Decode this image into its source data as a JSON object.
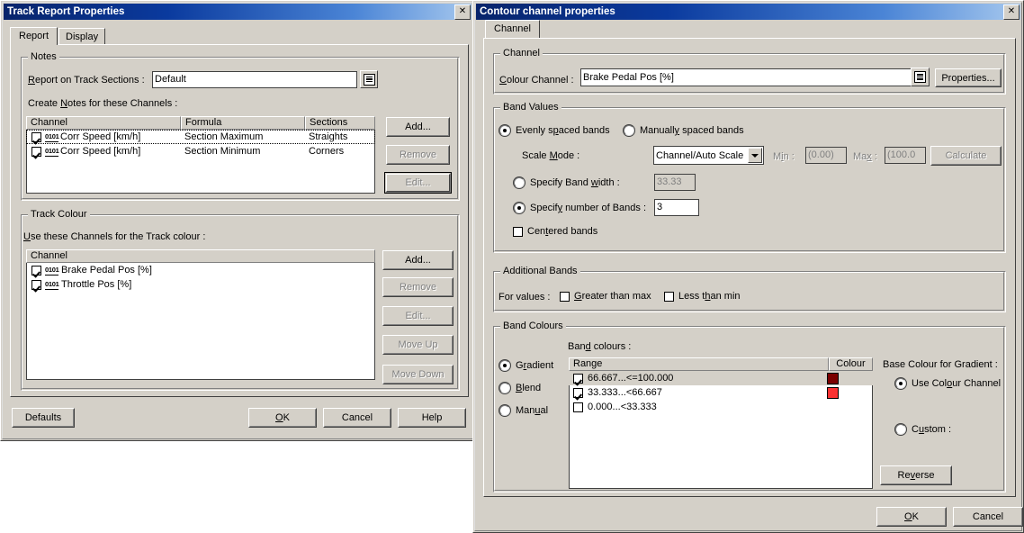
{
  "left_dialog": {
    "title": "Track Report Properties",
    "close_label": "✕",
    "tabs": [
      {
        "label": "Report",
        "selected": true
      },
      {
        "label": "Display",
        "selected": false
      }
    ],
    "notes_group": {
      "title": "Notes",
      "report_on_label": "Report on Track Sections :",
      "report_on_value": "Default",
      "browse_icon": "list-icon",
      "create_notes_label": "Create Notes for these Channels :",
      "columns": [
        "Channel",
        "Formula",
        "Sections"
      ],
      "rows": [
        {
          "checked": true,
          "icon": "0101",
          "channel": "Corr Speed [km/h]",
          "formula": "Section Maximum",
          "sections": "Straights",
          "focused": true
        },
        {
          "checked": true,
          "icon": "0101",
          "channel": "Corr Speed [km/h]",
          "formula": "Section Minimum",
          "sections": "Corners",
          "focused": false
        }
      ],
      "buttons": [
        {
          "label": "Add...",
          "enabled": true,
          "default": false
        },
        {
          "label": "Remove",
          "enabled": false,
          "default": false
        },
        {
          "label": "Edit...",
          "enabled": false,
          "default": true
        }
      ]
    },
    "track_colour_group": {
      "title": "Track Colour",
      "use_channels_label": "Use these Channels for the Track colour :",
      "columns": [
        "Channel"
      ],
      "rows": [
        {
          "checked": true,
          "icon": "0101",
          "channel": "Brake Pedal Pos [%]"
        },
        {
          "checked": true,
          "icon": "0101",
          "channel": "Throttle Pos [%]"
        }
      ],
      "buttons": [
        {
          "label": "Add...",
          "enabled": true
        },
        {
          "label": "Remove",
          "enabled": false
        },
        {
          "label": "Edit...",
          "enabled": false
        },
        {
          "label": "Move Up",
          "enabled": false
        },
        {
          "label": "Move Down",
          "enabled": false
        }
      ]
    },
    "footer_buttons": [
      {
        "label": "Defaults",
        "default": false
      },
      {
        "label": "OK",
        "default": false
      },
      {
        "label": "Cancel",
        "default": false
      },
      {
        "label": "Help",
        "default": false
      }
    ]
  },
  "right_dialog": {
    "title": "Contour channel properties",
    "close_label": "✕",
    "tabs": [
      {
        "label": "Channel",
        "selected": true
      }
    ],
    "channel_group": {
      "title": "Channel",
      "colour_channel_label": "Colour Channel :",
      "colour_channel_value": "Brake Pedal Pos [%]",
      "browse_icon": "list-icon",
      "properties_button": "Properties..."
    },
    "band_values_group": {
      "title": "Band Values",
      "spacing_mode": "evenly",
      "evenly_label": "Evenly spaced bands",
      "manually_label": "Manually spaced bands",
      "scale_mode_label": "Scale Mode :",
      "scale_mode_value": "Channel/Auto Scale",
      "min_label": "Min :",
      "min_value": "(0.00)",
      "max_label": "Max :",
      "max_value": "(100.0",
      "calculate_button": "Calculate",
      "band_width_label": "Specify Band width :",
      "band_width_value": "33.33",
      "band_width_selected": false,
      "number_of_bands_label": "Specify number of Bands :",
      "number_of_bands_value": "3",
      "number_of_bands_selected": true,
      "centered_bands_label": "Centered bands",
      "centered_bands_checked": false
    },
    "additional_bands_group": {
      "title": "Additional Bands",
      "for_values_label": "For values :",
      "greater_than_max_label": "Greater than max",
      "greater_than_max_checked": false,
      "less_than_min_label": "Less than min",
      "less_than_min_checked": false
    },
    "band_colours_group": {
      "title": "Band Colours",
      "mode": "gradient",
      "modes": [
        {
          "label": "Gradient",
          "selected": true
        },
        {
          "label": "Blend",
          "selected": false
        },
        {
          "label": "Manual",
          "selected": false
        }
      ],
      "band_colours_label": "Band colours :",
      "columns": [
        "Range",
        "Colour"
      ],
      "rows": [
        {
          "checked": true,
          "range": "66.667...<=100.000",
          "colour": "#7a0000",
          "selected": true
        },
        {
          "checked": true,
          "range": "33.333...<66.667",
          "colour": "#fa3232",
          "selected": false
        },
        {
          "checked": false,
          "range": "0.000...<33.333",
          "colour": null,
          "selected": false
        }
      ],
      "base_colour_label": "Base Colour for Gradient :",
      "base_options": [
        {
          "label": "Use Colour Channel",
          "selected": true
        },
        {
          "label": "Custom :",
          "selected": false
        }
      ],
      "reverse_button": "Reverse"
    },
    "footer_buttons": [
      {
        "label": "OK",
        "default": false
      },
      {
        "label": "Cancel",
        "default": false
      }
    ]
  }
}
